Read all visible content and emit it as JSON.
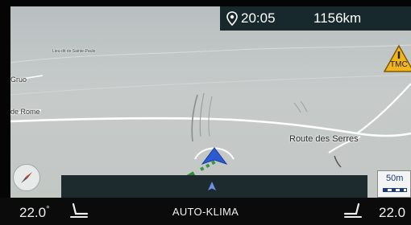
{
  "status": {
    "time": "20:05",
    "distance": "1156km",
    "pin_icon": "location-pin-icon"
  },
  "map": {
    "labels": {
      "small_place": "Lieu-dit de Sainte-Paule",
      "left_1": "Gruo",
      "left_2": "de Rome",
      "street": "Route des Serres"
    },
    "tmc_label": "TMC",
    "scale_value": "50m",
    "colors": {
      "route_green": "#2f8a3c",
      "position_arrow": "#2a5bd1",
      "roads": "#ffffff"
    }
  },
  "climate": {
    "temp_left": "22.0",
    "temp_left_suffix": "°",
    "mode": "AUTO-KLIMA",
    "temp_right": "22.0"
  }
}
